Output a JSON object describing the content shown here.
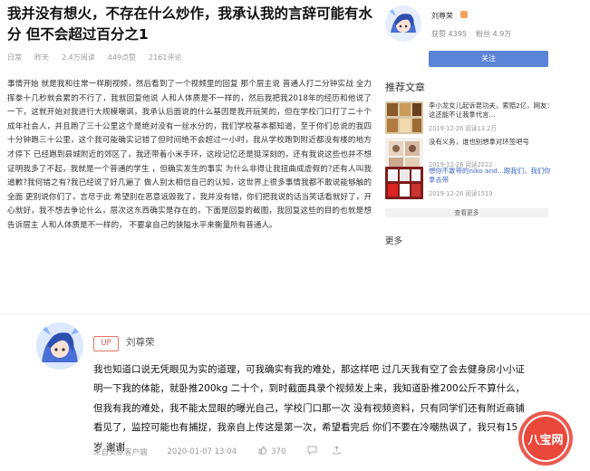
{
  "article": {
    "title": "我并没有想火，不存在什么炒作，我承认我的言辞可能有水分 但不会超过百分之1",
    "meta": [
      "日常",
      "昨天",
      "2.4万阅读",
      "449点赞",
      "2161评论"
    ],
    "body": "事情开始 就是我和往常一样刷视频，然后看到了一个视频里的回复 那个层主说 普通人打二分钟实战 全力挥拳十几秒就会累的不行了，我就回复他说 人和人体质是不一样的，然后我把我2018年的经历和他说了一下，这就开始对我进行大规模嘲讽，我承认后面说的什么基因是我开玩笑的，但在学校门口打了二十个成年社会人，并且跑了三十公里这个是绝对没有一丝水分的，我们学校基本都知道，至于你们总说的我四十分钟跑三十公里，这个我可能确实记错了但时间绝不会超过一小时，我从学校跑到附近都没有楼的地方才停下 已经跑到县城附近的郊区了，我还带着小米手环，这段记忆还是挺深刻的，还有我说这些也并不想证明我多了不起，我就是一个普通的学生 ，但确实发生的事实 为什么非得让我扭曲成虚假的?还有人叫我道歉?我何错之有?我已经说了好几遍了 做人别太相信自己的认知，这世界上很多事情我都不敢说能够触的全面 更别说你们了，言尽于此 希望别在恶意诋毁我了，我并没有错，你们把我说的话当笑话看就好了，开心就好，我不想去争论什么，层次这东西确实是存在的，下面是回复的截图，我回复这些的目的也就是想告诉层主 人和人体质是不一样的， 不要拿自己的狭隘水平来衡量所有普通人。"
  },
  "author": {
    "name": "刘尊荣",
    "stats_label_likes": "获赞",
    "stats_likes": "4395",
    "stats_label_fans": "粉丝",
    "stats_fans": "4.9万",
    "follow_label": "关注"
  },
  "recommend": {
    "title": "推荐文章",
    "items": [
      {
        "title": "李小龙女儿起诉昆功夫，索赔2亿，网友：这还能不让我拿代言...",
        "date": "2019-12-26 阅读13.2万",
        "blue": false
      },
      {
        "title": "没有义务，谁也别想拿对环签吧号",
        "date": "2019-12-26 阅读2222",
        "blue": false
      },
      {
        "title": "想你不敢带的niko and...跟我们，我们你拿去带",
        "date": "2019-12-26 阅读1519",
        "blue": true
      }
    ],
    "more_toggle": "查看更多",
    "more_label": "更多"
  },
  "comment": {
    "badge": "UP",
    "name": "刘尊荣",
    "text": "我也知道口说无凭眼见为实的道理，可我确实有我的难处，那这样吧 过几天我有空了会去健身房小小证明一下我的体能，就卧推200kg 二十个，到时截面具录个视频发上来，我知道卧推200公斤不算什么，但我有我的难处，我不能太显眼的曝光自己，学校门口那一次 没有视频资料，只有同学们还有附近商铺看见了，监控可能也有捕捉，我亲自上传这是第一次，希望看完后 你们不要在冷嘲热讽了，我只有15岁 谢谢",
    "source": "来自安卓客户端",
    "time": "2020-01-07 13:04",
    "likes": "370"
  },
  "watermark": {
    "text": "八宝网"
  }
}
